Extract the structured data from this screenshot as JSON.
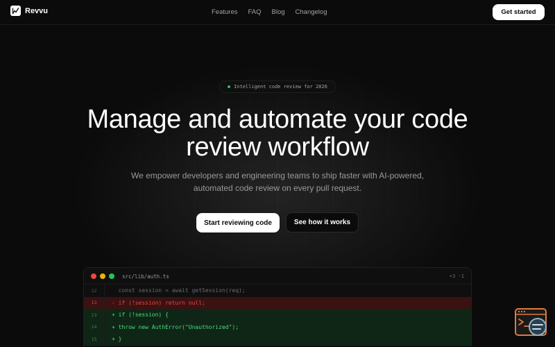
{
  "brand": {
    "name": "Revvu",
    "icon": "logo-chart-icon"
  },
  "nav": {
    "links": [
      "Features",
      "FAQ",
      "Blog",
      "Changelog"
    ],
    "cta_label": "Get started"
  },
  "hero": {
    "badge": "Intelligent code review for 2026",
    "headline_line1": "Manage and automate your code",
    "headline_line2": "review workflow",
    "sub_line1": "We empower developers and engineering teams to ship faster with AI-powered,",
    "sub_line2": "automated code review on every pull request.",
    "primary_label": "Start reviewing code",
    "secondary_label": "See how it works"
  },
  "code_window": {
    "filename": "src/lib/auth.ts",
    "diffstat": "+3 -1",
    "lines": [
      {
        "num": "12",
        "kind": "normal",
        "text": "  const session = await getSession(req);"
      },
      {
        "num": "13",
        "kind": "removed",
        "text": "- if (!session) return null;"
      },
      {
        "num": "13",
        "kind": "added",
        "text": "+ if (!session) {"
      },
      {
        "num": "14",
        "kind": "added",
        "text": "+ throw new AuthError(\"Unauthorized\");"
      },
      {
        "num": "15",
        "kind": "added",
        "text": "+ }"
      }
    ]
  },
  "colors": {
    "background": "#0b0b0b",
    "accent_green": "#22c55e",
    "removed_red": "#ef4444",
    "added_green": "#4ade80",
    "widget_orange": "#e07a3c"
  },
  "widget": {
    "icon": "terminal-chat-widget-icon"
  }
}
